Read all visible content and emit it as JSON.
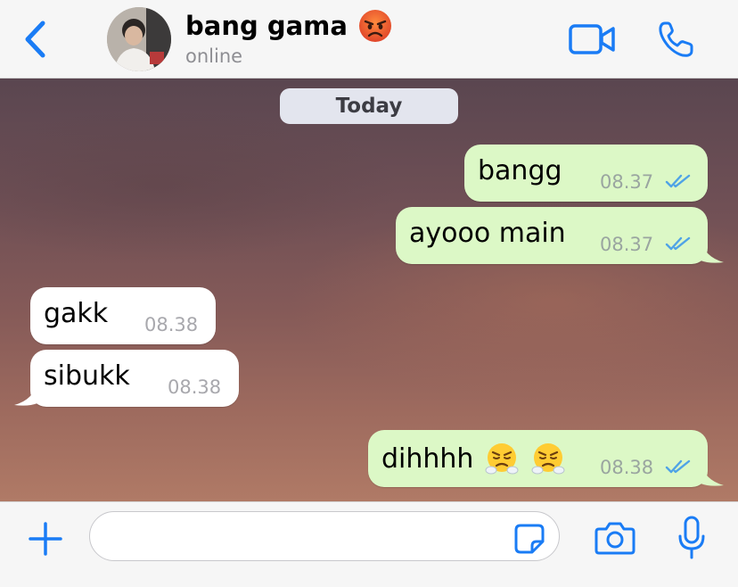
{
  "header": {
    "contact_name": "bang gama",
    "contact_status": "online",
    "name_emoji": "angry-face-emoji",
    "icons": {
      "back": "chevron-left-icon",
      "video": "video-call-icon",
      "call": "phone-icon"
    }
  },
  "chat": {
    "date_label": "Today",
    "messages": [
      {
        "direction": "outgoing",
        "text": "bangg",
        "time": "08.37",
        "status": "read"
      },
      {
        "direction": "outgoing",
        "text": "ayooo main",
        "time": "08.37",
        "status": "read"
      },
      {
        "direction": "incoming",
        "text": "gakk",
        "time": "08.38"
      },
      {
        "direction": "incoming",
        "text": "sibukk",
        "time": "08.38"
      },
      {
        "direction": "outgoing",
        "text": "dihhhh",
        "emoji": [
          "face-with-steam-emoji",
          "face-with-steam-emoji"
        ],
        "time": "08.38",
        "status": "read"
      }
    ]
  },
  "input_bar": {
    "placeholder": "",
    "icons": {
      "add": "plus-icon",
      "sticker": "sticker-icon",
      "camera": "camera-icon",
      "mic": "microphone-icon"
    }
  },
  "colors": {
    "accent": "#1a7cf5",
    "outgoing_bubble": "#dcf8c6",
    "incoming_bubble": "#ffffff",
    "read_ticks": "#4fa3e6"
  }
}
